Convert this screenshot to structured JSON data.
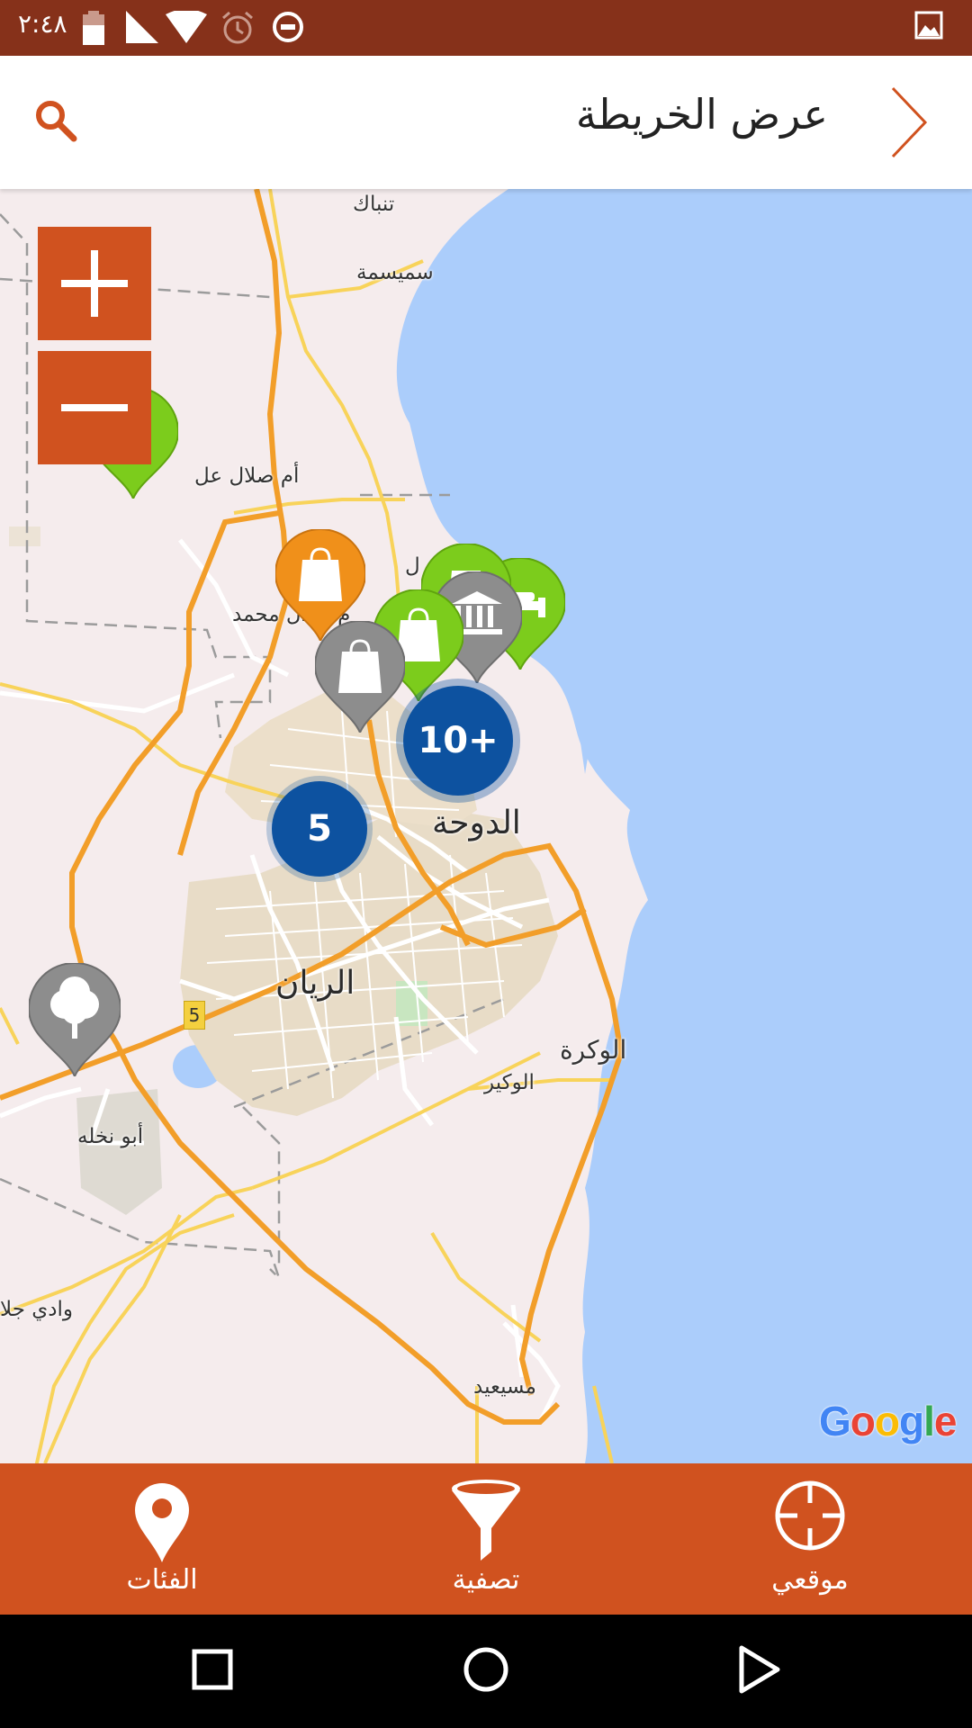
{
  "status_bar": {
    "time": "٢:٤٨",
    "icons": [
      "battery-icon",
      "signal-icon",
      "wifi-icon",
      "alarm-icon",
      "do-not-disturb-icon",
      "image-icon"
    ]
  },
  "app_bar": {
    "title": "عرض الخريطة",
    "search_icon": "search-icon",
    "back_icon": "chevron-right-icon"
  },
  "map": {
    "zoom_in_icon": "plus-icon",
    "zoom_out_icon": "minus-icon",
    "labels": {
      "tunbak": "تنباك",
      "sumaisma": "سميسمة",
      "umm_salal": "أم صلال عل",
      "umm_salal_mohammed": "م صلال محمد",
      "partial_al": "ل",
      "doha": "الدوحة",
      "rayyan": "الريان",
      "wakra": "الوكرة",
      "wukair": "الوكير",
      "abu_nakhla": "أبو نخله",
      "wadi_jallal": "وادي جلا",
      "mesaieed": "مسيعيد"
    },
    "route_number": "5",
    "clusters": [
      {
        "label": "10+",
        "color": "#0d52a0"
      },
      {
        "label": "5",
        "color": "#0d52a0"
      }
    ],
    "pins": [
      {
        "name": "park-pin",
        "icon": "tree-icon",
        "color": "#8d8d8d"
      },
      {
        "name": "shopping-pin-orange",
        "icon": "shopping-bag-icon",
        "color": "#f0901a"
      },
      {
        "name": "shopping-pin-green",
        "icon": "shopping-bag-icon",
        "color": "#7ccc1c"
      },
      {
        "name": "shopping-pin-gray",
        "icon": "shopping-bag-icon",
        "color": "#8d8d8d"
      },
      {
        "name": "museum-pin",
        "icon": "museum-icon",
        "color": "#8d8d8d"
      },
      {
        "name": "hotel-pin",
        "icon": "bed-icon",
        "color": "#7ccc1c"
      }
    ],
    "attribution": "Google"
  },
  "bottom_nav": {
    "categories_label": "الفئات",
    "filter_label": "تصفية",
    "my_location_label": "موقعي",
    "categories_icon": "map-pin-icon",
    "filter_icon": "funnel-icon",
    "my_location_icon": "crosshair-icon"
  },
  "colors": {
    "status_bar": "#86311a",
    "accent": "#d0521f",
    "water": "#abcdfb",
    "land": "#f5eced",
    "cluster": "#0d52a0"
  }
}
